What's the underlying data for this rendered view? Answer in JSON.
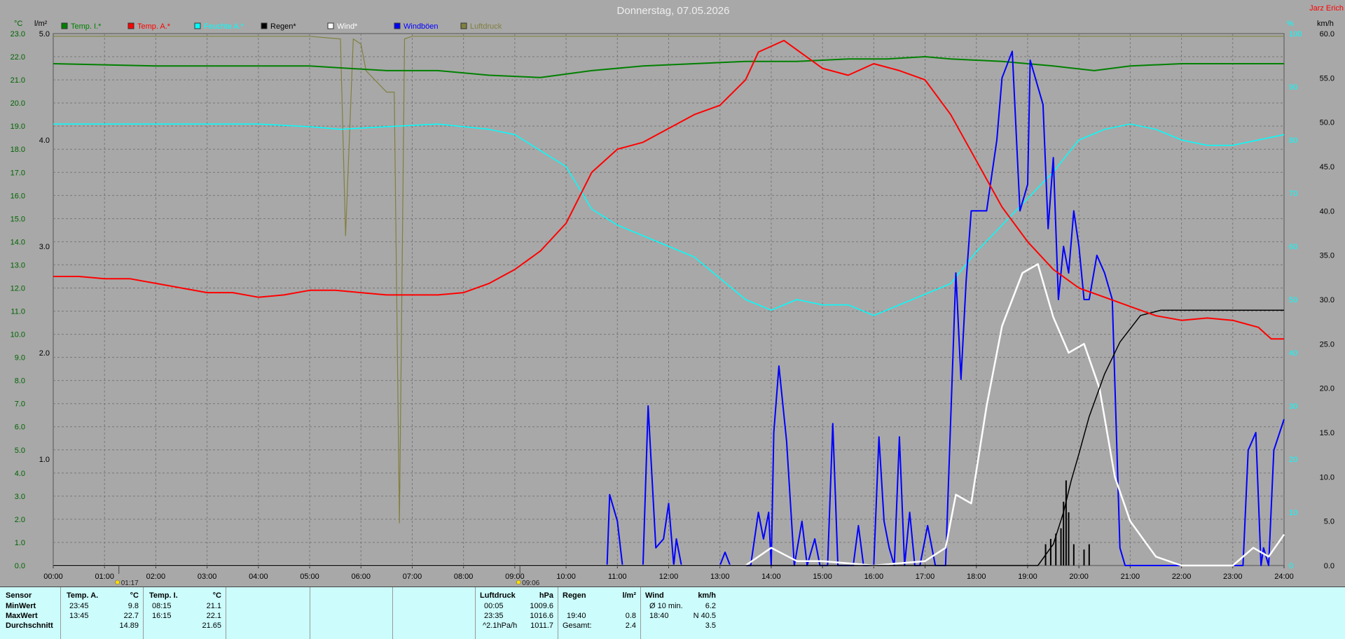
{
  "header": {
    "title": "Donnerstag, 07.05.2026",
    "author": "Jarz Erich"
  },
  "axes": {
    "temp_unit": "°C",
    "rain_unit": "l/m²",
    "pct_unit": "%",
    "wind_unit": "km/h",
    "temp_ticks": [
      "0.0",
      "1.0",
      "2.0",
      "3.0",
      "4.0",
      "5.0",
      "6.0",
      "7.0",
      "8.0",
      "9.0",
      "10.0",
      "11.0",
      "12.0",
      "13.0",
      "14.0",
      "15.0",
      "16.0",
      "17.0",
      "18.0",
      "19.0",
      "20.0",
      "21.0",
      "22.0",
      "23.0"
    ],
    "rain_ticks": [
      "1.0",
      "2.0",
      "3.0",
      "4.0",
      "5.0"
    ],
    "pct_ticks": [
      "0",
      "10",
      "20",
      "30",
      "40",
      "50",
      "60",
      "70",
      "80",
      "90",
      "100"
    ],
    "wind_ticks": [
      "0.0",
      "5.0",
      "10.0",
      "15.0",
      "20.0",
      "25.0",
      "30.0",
      "35.0",
      "40.0",
      "45.0",
      "50.0",
      "55.0",
      "60.0"
    ],
    "time_ticks": [
      "00:00",
      "01:00",
      "02:00",
      "03:00",
      "04:00",
      "05:00",
      "06:00",
      "07:00",
      "08:00",
      "09:00",
      "10:00",
      "11:00",
      "12:00",
      "13:00",
      "14:00",
      "15:00",
      "16:00",
      "17:00",
      "18:00",
      "19:00",
      "20:00",
      "21:00",
      "22:00",
      "23:00",
      "24:00"
    ]
  },
  "markers": {
    "sunrise": "01:17",
    "sunset": "09:06"
  },
  "legend": [
    {
      "label": "Temp. I.*",
      "color": "#008000"
    },
    {
      "label": "Temp. A.*",
      "color": "#ff0000"
    },
    {
      "label": "Feuchte A.*",
      "color": "#00ffff"
    },
    {
      "label": "Regen*",
      "color": "#000000"
    },
    {
      "label": "Wind*",
      "color": "#ffffff"
    },
    {
      "label": "Windböen",
      "color": "#0000ff"
    },
    {
      "label": "Luftdruck",
      "color": "#808040"
    }
  ],
  "chart_data": {
    "type": "line",
    "x_unit": "hours",
    "x_range": [
      0,
      24
    ],
    "y_ranges": {
      "temp": [
        0,
        23
      ],
      "rain": [
        0,
        5
      ],
      "pct": [
        0,
        100
      ],
      "wind": [
        0,
        60
      ]
    },
    "grid": true,
    "series": [
      {
        "name": "Temp. I.*",
        "axis": "temp",
        "color": "#008000",
        "points": [
          [
            0,
            21.7
          ],
          [
            2,
            21.6
          ],
          [
            5,
            21.6
          ],
          [
            6.5,
            21.4
          ],
          [
            7.5,
            21.4
          ],
          [
            8.5,
            21.2
          ],
          [
            9.5,
            21.1
          ],
          [
            10.5,
            21.4
          ],
          [
            11.5,
            21.6
          ],
          [
            12.5,
            21.7
          ],
          [
            13.5,
            21.8
          ],
          [
            14.5,
            21.8
          ],
          [
            15.5,
            21.9
          ],
          [
            16.25,
            21.9
          ],
          [
            17,
            22.0
          ],
          [
            17.5,
            21.9
          ],
          [
            18.5,
            21.8
          ],
          [
            19.5,
            21.6
          ],
          [
            20.3,
            21.4
          ],
          [
            21,
            21.6
          ],
          [
            22,
            21.7
          ],
          [
            23,
            21.7
          ],
          [
            24,
            21.7
          ]
        ]
      },
      {
        "name": "Temp. A.*",
        "axis": "temp",
        "color": "#ff0000",
        "points": [
          [
            0,
            12.5
          ],
          [
            0.5,
            12.5
          ],
          [
            1,
            12.4
          ],
          [
            1.5,
            12.4
          ],
          [
            2,
            12.2
          ],
          [
            2.5,
            12.0
          ],
          [
            3,
            11.8
          ],
          [
            3.5,
            11.8
          ],
          [
            4,
            11.6
          ],
          [
            4.5,
            11.7
          ],
          [
            5,
            11.9
          ],
          [
            5.5,
            11.9
          ],
          [
            6,
            11.8
          ],
          [
            6.5,
            11.7
          ],
          [
            7,
            11.7
          ],
          [
            7.5,
            11.7
          ],
          [
            8,
            11.8
          ],
          [
            8.5,
            12.2
          ],
          [
            9,
            12.8
          ],
          [
            9.5,
            13.6
          ],
          [
            10,
            14.8
          ],
          [
            10.5,
            17.0
          ],
          [
            11,
            18.0
          ],
          [
            11.5,
            18.3
          ],
          [
            12,
            18.9
          ],
          [
            12.5,
            19.5
          ],
          [
            13,
            19.9
          ],
          [
            13.5,
            21.0
          ],
          [
            13.75,
            22.2
          ],
          [
            14.25,
            22.7
          ],
          [
            15,
            21.5
          ],
          [
            15.5,
            21.2
          ],
          [
            16,
            21.7
          ],
          [
            16.5,
            21.4
          ],
          [
            17,
            21.0
          ],
          [
            17.5,
            19.5
          ],
          [
            18,
            17.5
          ],
          [
            18.5,
            15.5
          ],
          [
            19,
            14.0
          ],
          [
            19.5,
            12.8
          ],
          [
            20,
            12.0
          ],
          [
            20.5,
            11.6
          ],
          [
            21,
            11.2
          ],
          [
            21.5,
            10.8
          ],
          [
            22,
            10.6
          ],
          [
            22.5,
            10.7
          ],
          [
            23,
            10.6
          ],
          [
            23.5,
            10.3
          ],
          [
            23.75,
            9.8
          ],
          [
            24,
            9.8
          ]
        ]
      },
      {
        "name": "Feuchte A.*",
        "axis": "pct",
        "color": "#00ffff",
        "points": [
          [
            0,
            83
          ],
          [
            1,
            83
          ],
          [
            2,
            83
          ],
          [
            3,
            83
          ],
          [
            4,
            83
          ],
          [
            5,
            82.5
          ],
          [
            5.6,
            82
          ],
          [
            6.5,
            82.5
          ],
          [
            7.5,
            83
          ],
          [
            8.5,
            82
          ],
          [
            9,
            81
          ],
          [
            9.5,
            78
          ],
          [
            10,
            75
          ],
          [
            10.5,
            67
          ],
          [
            11,
            64
          ],
          [
            11.5,
            62
          ],
          [
            12,
            60
          ],
          [
            12.5,
            58
          ],
          [
            13,
            54
          ],
          [
            13.5,
            50
          ],
          [
            14,
            48
          ],
          [
            14.5,
            50
          ],
          [
            15,
            49
          ],
          [
            15.5,
            49
          ],
          [
            16,
            47
          ],
          [
            16.5,
            49
          ],
          [
            17,
            51
          ],
          [
            17.5,
            53
          ],
          [
            18,
            59
          ],
          [
            18.5,
            64
          ],
          [
            19,
            69
          ],
          [
            19.5,
            74
          ],
          [
            20,
            80
          ],
          [
            20.5,
            82
          ],
          [
            21,
            83
          ],
          [
            21.5,
            82
          ],
          [
            22,
            80
          ],
          [
            22.5,
            79
          ],
          [
            23,
            79
          ],
          [
            23.5,
            80
          ],
          [
            24,
            81
          ]
        ]
      },
      {
        "name": "Luftdruck",
        "axis": "pct",
        "color": "#808040",
        "points": [
          [
            0,
            99.5
          ],
          [
            1,
            99.5
          ],
          [
            2,
            99.5
          ],
          [
            3,
            99.5
          ],
          [
            4,
            99.5
          ],
          [
            5,
            99.5
          ],
          [
            5.6,
            99
          ],
          [
            5.7,
            62
          ],
          [
            5.85,
            99
          ],
          [
            6,
            98
          ],
          [
            6.1,
            93
          ],
          [
            6.5,
            89
          ],
          [
            6.65,
            89
          ],
          [
            6.75,
            8
          ],
          [
            6.85,
            99
          ],
          [
            7,
            99.5
          ],
          [
            9,
            99.5
          ],
          [
            12,
            99.5
          ],
          [
            15,
            99.5
          ],
          [
            18,
            99.5
          ],
          [
            21,
            99.5
          ],
          [
            24,
            99.5
          ]
        ]
      },
      {
        "name": "Regen*",
        "axis": "rain",
        "color": "#000000",
        "points": [
          [
            0,
            0
          ],
          [
            19.2,
            0
          ],
          [
            19.5,
            0.2
          ],
          [
            19.7,
            0.5
          ],
          [
            19.85,
            0.8
          ],
          [
            20,
            1.05
          ],
          [
            20.2,
            1.4
          ],
          [
            20.5,
            1.8
          ],
          [
            20.8,
            2.1
          ],
          [
            21.2,
            2.35
          ],
          [
            21.6,
            2.4
          ],
          [
            24,
            2.4
          ]
        ]
      },
      {
        "name": "Wind*",
        "axis": "wind",
        "color": "#ffffff",
        "points": [
          [
            0,
            0
          ],
          [
            13.5,
            0
          ],
          [
            14,
            2
          ],
          [
            14.5,
            0.5
          ],
          [
            15,
            0.5
          ],
          [
            16,
            0
          ],
          [
            17,
            0.5
          ],
          [
            17.4,
            2
          ],
          [
            17.6,
            8
          ],
          [
            17.9,
            7
          ],
          [
            18.2,
            18
          ],
          [
            18.5,
            27
          ],
          [
            18.9,
            33
          ],
          [
            19.2,
            34
          ],
          [
            19.5,
            28
          ],
          [
            19.8,
            24
          ],
          [
            20.1,
            25
          ],
          [
            20.4,
            20
          ],
          [
            20.7,
            10
          ],
          [
            21.0,
            5
          ],
          [
            21.5,
            1
          ],
          [
            22,
            0
          ],
          [
            23,
            0
          ],
          [
            23.4,
            2
          ],
          [
            23.7,
            1
          ],
          [
            24,
            3.5
          ]
        ]
      },
      {
        "name": "Windböen",
        "axis": "wind",
        "color": "#0000ff",
        "points": [
          [
            0,
            0
          ],
          [
            10.8,
            0
          ],
          [
            10.85,
            8
          ],
          [
            11.0,
            5
          ],
          [
            11.1,
            0
          ],
          [
            11.5,
            0
          ],
          [
            11.6,
            18
          ],
          [
            11.75,
            2
          ],
          [
            11.9,
            3
          ],
          [
            12.0,
            7
          ],
          [
            12.1,
            0
          ],
          [
            12.15,
            3
          ],
          [
            12.25,
            0
          ],
          [
            13,
            0
          ],
          [
            13.1,
            1.5
          ],
          [
            13.2,
            0
          ],
          [
            13.6,
            0
          ],
          [
            13.75,
            6
          ],
          [
            13.85,
            3
          ],
          [
            13.95,
            6
          ],
          [
            14.0,
            0
          ],
          [
            14.05,
            15
          ],
          [
            14.15,
            22.5
          ],
          [
            14.3,
            14
          ],
          [
            14.45,
            0
          ],
          [
            14.6,
            5
          ],
          [
            14.7,
            0
          ],
          [
            14.85,
            3
          ],
          [
            14.95,
            0
          ],
          [
            15.1,
            0
          ],
          [
            15.2,
            16
          ],
          [
            15.3,
            0
          ],
          [
            15.6,
            0
          ],
          [
            15.7,
            4.5
          ],
          [
            15.8,
            0
          ],
          [
            16.0,
            0
          ],
          [
            16.1,
            14.5
          ],
          [
            16.2,
            5
          ],
          [
            16.3,
            2
          ],
          [
            16.4,
            0
          ],
          [
            16.5,
            14.5
          ],
          [
            16.6,
            0
          ],
          [
            16.7,
            6
          ],
          [
            16.8,
            0
          ],
          [
            16.9,
            0
          ],
          [
            17.05,
            4.5
          ],
          [
            17.2,
            0
          ],
          [
            17.4,
            0
          ],
          [
            17.6,
            33
          ],
          [
            17.7,
            21
          ],
          [
            17.8,
            32
          ],
          [
            17.9,
            40
          ],
          [
            18.0,
            40
          ],
          [
            18.2,
            40
          ],
          [
            18.4,
            48
          ],
          [
            18.5,
            55
          ],
          [
            18.7,
            58
          ],
          [
            18.85,
            40
          ],
          [
            19.0,
            43
          ],
          [
            19.05,
            57
          ],
          [
            19.3,
            52
          ],
          [
            19.4,
            38
          ],
          [
            19.45,
            42
          ],
          [
            19.5,
            46
          ],
          [
            19.6,
            30
          ],
          [
            19.7,
            36
          ],
          [
            19.8,
            33
          ],
          [
            19.9,
            40
          ],
          [
            20.0,
            36
          ],
          [
            20.1,
            30
          ],
          [
            20.2,
            30
          ],
          [
            20.35,
            35
          ],
          [
            20.5,
            33
          ],
          [
            20.65,
            30
          ],
          [
            20.8,
            2
          ],
          [
            20.9,
            0
          ],
          [
            23.2,
            0
          ],
          [
            23.3,
            13
          ],
          [
            23.45,
            15
          ],
          [
            23.55,
            0
          ],
          [
            23.6,
            2
          ],
          [
            23.7,
            0
          ],
          [
            23.8,
            13
          ],
          [
            24,
            16.5
          ]
        ]
      }
    ],
    "rain_bars": {
      "name": "Regen*",
      "axis": "rain",
      "color": "#000000",
      "points": [
        [
          19.35,
          0.2
        ],
        [
          19.45,
          0.25
        ],
        [
          19.55,
          0.3
        ],
        [
          19.65,
          0.35
        ],
        [
          19.7,
          0.6
        ],
        [
          19.75,
          0.8
        ],
        [
          19.8,
          0.5
        ],
        [
          19.9,
          0.2
        ],
        [
          20.1,
          0.15
        ],
        [
          20.2,
          0.2
        ]
      ]
    }
  },
  "stats": {
    "sensor_label": "Sensor",
    "row_labels": [
      "MinWert",
      "MaxWert",
      "Durchschnitt"
    ],
    "temp_a": {
      "label": "Temp. A.",
      "unit": "°C",
      "times": [
        "23:45",
        "13:45",
        ""
      ],
      "values": [
        "9.8",
        "22.7",
        "14.89"
      ]
    },
    "temp_i": {
      "label": "Temp. I.",
      "unit": "°C",
      "times": [
        "08:15",
        "16:15",
        ""
      ],
      "values": [
        "21.1",
        "22.1",
        "21.65"
      ]
    },
    "pressure": {
      "label": "Luftdruck",
      "unit": "hPa",
      "times": [
        "00:05",
        "23:35",
        "^2.1hPa/h"
      ],
      "values": [
        "1009.6",
        "1016.6",
        "1011.7"
      ]
    },
    "rain": {
      "label": "Regen",
      "unit": "l/m²",
      "times": [
        "",
        "19:40",
        "Gesamt:"
      ],
      "values": [
        "",
        "0.8",
        "2.4"
      ]
    },
    "wind": {
      "label": "Wind",
      "unit": "km/h",
      "times": [
        "Ø 10 min.",
        "18:40",
        ""
      ],
      "values": [
        "6.2",
        "N 40.5",
        "3.5"
      ]
    }
  }
}
